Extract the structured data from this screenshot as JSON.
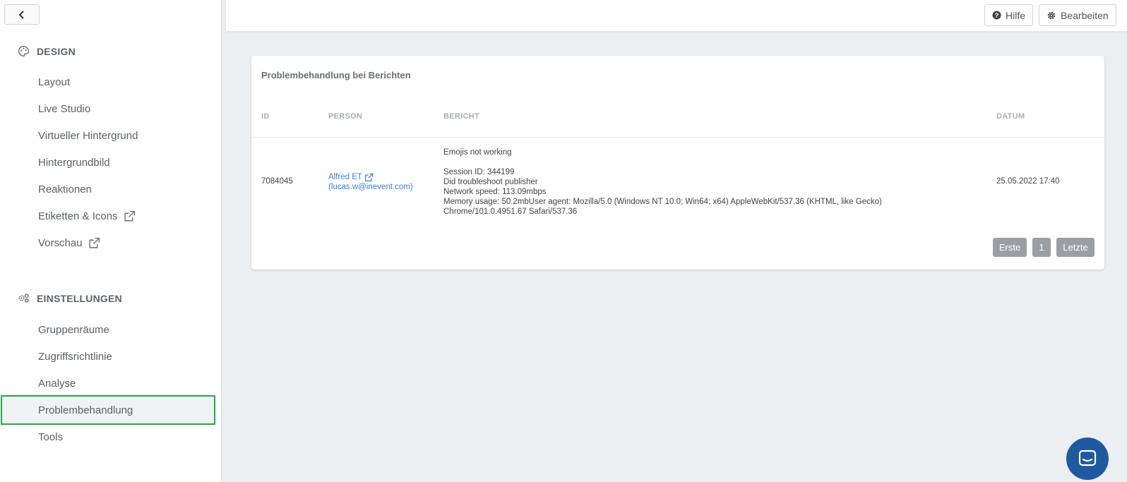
{
  "sidebar": {
    "design": {
      "title": "DESIGN",
      "items": [
        {
          "label": "Layout"
        },
        {
          "label": "Live Studio"
        },
        {
          "label": "Virtueller Hintergrund"
        },
        {
          "label": "Hintergrundbild"
        },
        {
          "label": "Reaktionen"
        },
        {
          "label": "Etiketten & Icons"
        },
        {
          "label": "Vorschau"
        }
      ]
    },
    "settings": {
      "title": "EINSTELLUNGEN",
      "items": [
        {
          "label": "Gruppenräume"
        },
        {
          "label": "Zugriffsrichtlinie"
        },
        {
          "label": "Analyse"
        },
        {
          "label": "Problembehandlung"
        },
        {
          "label": "Tools"
        }
      ]
    }
  },
  "topbar": {
    "help_label": "Hilfe",
    "edit_label": "Bearbeiten"
  },
  "card": {
    "title": "Problembehandlung bei Berichten",
    "columns": [
      "ID",
      "PERSON",
      "BERICHT",
      "DATUM"
    ],
    "row": {
      "id": "7084045",
      "person_name": "Alfred ET",
      "person_email": "(lucas.w@inevent.com)",
      "report_lines": [
        "Emojis not working",
        "",
        "Session ID: 344199",
        "Did troubleshoot publisher",
        "Network speed: 113.09mbps",
        "Memory usage: 50.2mbUser agent: Mozilla/5.0 (Windows NT 10.0; Win64; x64) AppleWebKit/537.36 (KHTML, like Gecko)",
        "Chrome/101.0.4951.67 Safari/537.36"
      ],
      "date": "25.05.2022 17:40"
    },
    "pagination": {
      "first": "Erste",
      "page": "1",
      "last": "Letzte"
    }
  },
  "colors": {
    "active_border": "#22aa44",
    "link": "#3a82d6",
    "chat": "#1f5aa0"
  }
}
